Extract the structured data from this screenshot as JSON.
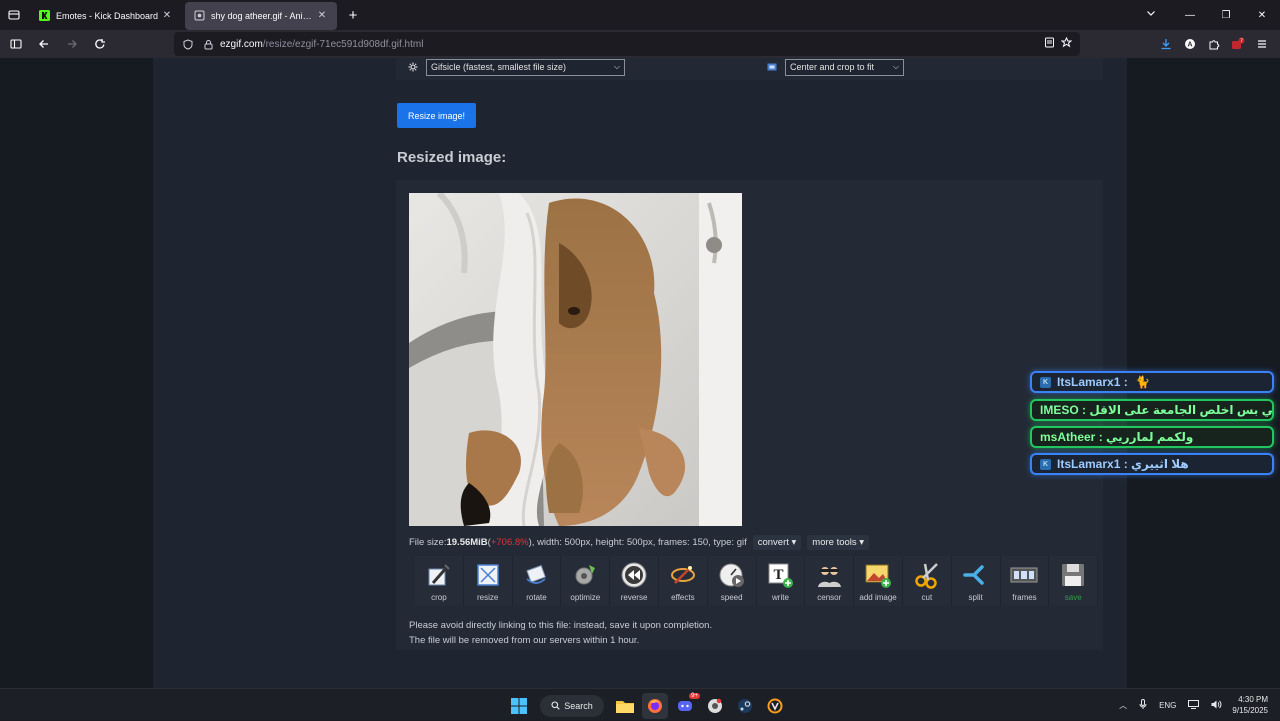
{
  "tabs": [
    {
      "label": "Emotes - Kick Dashboard",
      "active": false
    },
    {
      "label": "shy dog atheer.gif - Animated GIF",
      "active": true
    }
  ],
  "url": {
    "host": "ezgif.com",
    "path": "/resize/ezgif-71ec591d908df.gif.html"
  },
  "options": {
    "method_select": "Gifsicle (fastest, smallest file size)",
    "crop_select": "Center and crop to fit"
  },
  "resize_button": "Resize image!",
  "resized_title": "Resized image:",
  "file_info": {
    "prefix": "File size: ",
    "size": "19.56MiB",
    "open_paren": " (",
    "change": "+706.8%",
    "rest": "), width: 500px, height: 500px, frames: 150, type: gif",
    "convert": "convert ▾",
    "more_tools": "more tools ▾"
  },
  "tools": [
    {
      "label": "crop",
      "icon": "crop-icon"
    },
    {
      "label": "resize",
      "icon": "resize-icon"
    },
    {
      "label": "rotate",
      "icon": "rotate-icon"
    },
    {
      "label": "optimize",
      "icon": "optimize-icon"
    },
    {
      "label": "reverse",
      "icon": "reverse-icon"
    },
    {
      "label": "effects",
      "icon": "effects-icon"
    },
    {
      "label": "speed",
      "icon": "speed-icon"
    },
    {
      "label": "write",
      "icon": "write-icon"
    },
    {
      "label": "censor",
      "icon": "censor-icon"
    },
    {
      "label": "add image",
      "icon": "add-image-icon"
    },
    {
      "label": "cut",
      "icon": "scissors-icon"
    },
    {
      "label": "split",
      "icon": "split-icon"
    },
    {
      "label": "frames",
      "icon": "frames-icon"
    },
    {
      "label": "save",
      "icon": "save-icon"
    }
  ],
  "notes": {
    "line1": "Please avoid directly linking to this file: instead, save it upon completion.",
    "line2": "The file will be removed from our servers within 1 hour."
  },
  "chat": [
    {
      "user": "ItsLamarx1",
      "sep": " : ",
      "msg": "🐈",
      "style": "blue",
      "badge": true
    },
    {
      "user": "IMESO",
      "sep": " : ",
      "msg": "منطقي بس اخلص الجامعة على الاقل",
      "style": "green",
      "badge": false
    },
    {
      "user": "msAtheer",
      "sep": " : ",
      "msg": "ولكمم لمارريي",
      "style": "green",
      "badge": false
    },
    {
      "user": "ItsLamarx1",
      "sep": " : ",
      "msg": "هلا اثييري",
      "style": "blue",
      "badge": true
    }
  ],
  "taskbar": {
    "search": "Search",
    "lang": "ENG",
    "time": "4:30 PM",
    "date": "9/15/2025",
    "discord_badge": "9+"
  },
  "colors": {
    "accent": "#1a73e8",
    "size_change": "#d9363e",
    "save_label": "#2f9e44"
  }
}
